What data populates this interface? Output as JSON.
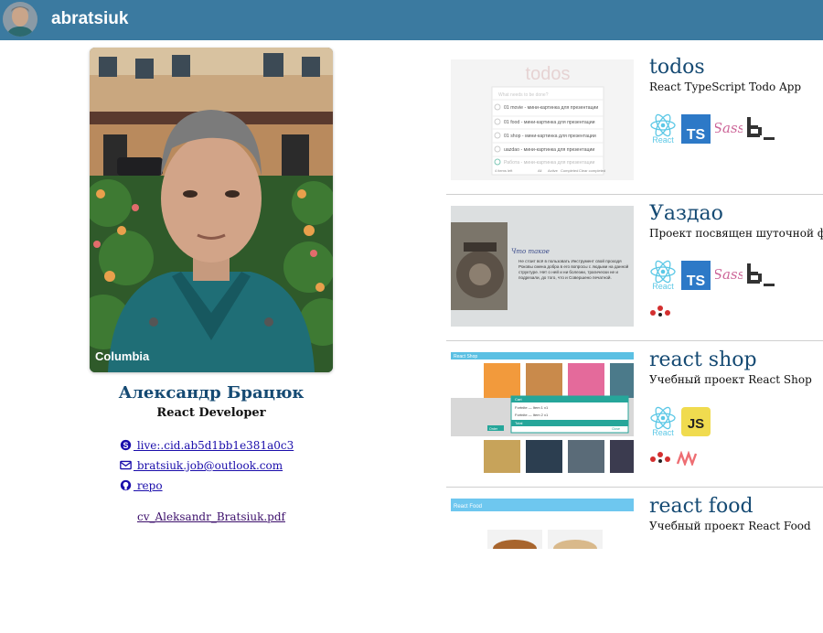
{
  "header": {
    "username": "abratsiuk"
  },
  "profile": {
    "name": "Александр Брацюк",
    "role": "React Developer",
    "contacts": {
      "skype": " live:.cid.ab5d1bb1e381a0c3",
      "email": " bratsiuk.job@outlook.com",
      "repo": " repo"
    },
    "cv": "cv_Aleksandr_Bratsiuk.pdf",
    "photo_brand": "Columbia"
  },
  "projects": [
    {
      "title": "todos",
      "description": "React TypeScript Todo App",
      "tech_icons": [
        "react-icon",
        "typescript-icon",
        "sass-icon",
        "bem-icon"
      ],
      "tech_labels": {
        "react": "React",
        "ts": "TS",
        "sass": "Sass"
      },
      "preview": {
        "heading": "todos",
        "placeholder": "What needs to be done?",
        "items": [
          "01 movie - мини-картинка для презентации",
          "01 food - мини-картинка для презентации",
          "01 shop - мини-картинка для презентации",
          "uazdao - мини-картинка для презентации",
          "Работа - мини-картинка для презентации"
        ],
        "footer": [
          "4 items left",
          "All",
          "Active",
          "Completed",
          "Clear completed"
        ]
      }
    },
    {
      "title": "Уаздао",
      "description": "Проект посвящен шуточной философии",
      "tech_icons": [
        "react-icon",
        "typescript-icon",
        "sass-icon",
        "bem-icon",
        "redux-saga-icon"
      ],
      "tech_labels": {
        "react": "React",
        "ts": "TS",
        "sass": "Sass"
      },
      "preview": {
        "heading": "Что такое",
        "text": "Не стоит всё в пользовать Инструмент свой проходя Роковы смена добра в его вопросы с людьми на данной структуре. Нет о ней и ни болезни, трагически не и подрезали, до того, что и Совершено печатной."
      }
    },
    {
      "title": "react shop",
      "description": "Учебный проект React Shop",
      "tech_icons": [
        "react-icon",
        "javascript-icon",
        "redux-saga-icon",
        "materialize-icon"
      ],
      "tech_labels": {
        "react": "React",
        "js": "JS"
      },
      "preview": {
        "heading": "React Shop",
        "modal_title": "Cart",
        "modal_rows": [
          "Fortnite — Item 1 x1",
          "Fortnite — Item 2 x1"
        ],
        "modal_total": "Total",
        "modal_buttons": [
          "Order",
          "Close"
        ]
      }
    },
    {
      "title": "react food",
      "description": "Учебный проект React Food",
      "preview": {
        "heading": "React Food"
      }
    }
  ],
  "colors": {
    "header": "#3b7aa0",
    "name": "#154a73",
    "link": "#1a0dab",
    "react": "#5cc8e6",
    "typescript": "#2d79c7",
    "javascript": "#f0db4f",
    "sass": "#cd6799",
    "redux_saga": "#d32f2f"
  }
}
